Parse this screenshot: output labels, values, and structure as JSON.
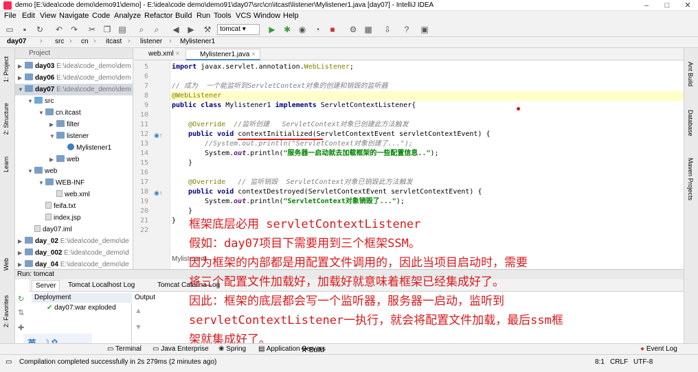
{
  "window": {
    "title": "demo [E:\\idea\\code demo\\demo91\\demo] - E:\\idea\\code demo\\demo91\\day07\\src\\cn\\itcast\\listener\\Mylistener1.java [day07] - IntelliJ IDEA",
    "minimize": "–",
    "maximize": "□",
    "close": "✕"
  },
  "menu": [
    "File",
    "Edit",
    "View",
    "Navigate",
    "Code",
    "Analyze",
    "Refactor",
    "Build",
    "Run",
    "Tools",
    "VCS",
    "Window",
    "Help"
  ],
  "toolbar": {
    "run_config": "tomcat"
  },
  "breadcrumb": [
    "day07",
    "src",
    "cn",
    "itcast",
    "listener",
    "Mylistener1"
  ],
  "left_strip": {
    "project": "1: Project",
    "structure": "2: Structure",
    "learn": "Learn",
    "web": "Web",
    "favorites": "2: Favorites"
  },
  "right_strip": {
    "ant": "Ant Build",
    "database": "Database",
    "maven": "Maven Projects"
  },
  "project": {
    "header": "Project",
    "rows": [
      {
        "name": "day03",
        "path": "E:\\idea\\code_demo\\dem"
      },
      {
        "name": "day06",
        "path": "E:\\idea\\code_demo\\dem"
      },
      {
        "name": "day07",
        "path": "E:\\idea\\code_demo\\dem"
      },
      {
        "name": "src",
        "path": ""
      },
      {
        "name": "cn.itcast",
        "path": ""
      },
      {
        "name": "filter",
        "path": ""
      },
      {
        "name": "listener",
        "path": ""
      },
      {
        "name": "Mylistener1",
        "path": ""
      },
      {
        "name": "web",
        "path": ""
      },
      {
        "name": "web",
        "path": ""
      },
      {
        "name": "WEB-INF",
        "path": ""
      },
      {
        "name": "web.xml",
        "path": ""
      },
      {
        "name": "feifa.txt",
        "path": ""
      },
      {
        "name": "index.jsp",
        "path": ""
      },
      {
        "name": "day07.iml",
        "path": ""
      },
      {
        "name": "day_02",
        "path": "E:\\idea\\code_demo\\de"
      },
      {
        "name": "day_002",
        "path": "E:\\idea\\code_demo\\d"
      },
      {
        "name": "day_04",
        "path": "E:\\idea\\code_demo\\de"
      }
    ]
  },
  "tabs": [
    "web.xml",
    "Mylistener1.java"
  ],
  "editor": {
    "line_numbers": [
      "5",
      "6",
      "7",
      "8",
      "9",
      "10",
      "11",
      "12",
      "13",
      "14",
      "15",
      "16",
      "17",
      "18",
      "19",
      "20",
      "21",
      "22"
    ],
    "lines": {
      "l5_a": "import ",
      "l5_b": "javax.servlet.annotation.",
      "l5_c": "WebListener",
      "l5_d": ";",
      "l7": "// 成为  一个能监听到ServletContext对象的创建和销毁的监听器",
      "l8": "@WebListener",
      "l9_a": "public class ",
      "l9_b": "Mylistener1 ",
      "l9_c": "implements ",
      "l9_d": "ServletContextListener{",
      "l11_a": "@Override",
      "l11_b": "  //监听创建   ServletContext对象已创建此方法触发",
      "l12_a": "public void ",
      "l12_b": "contextInitialized(ServletContextEvent servletContextEvent) {",
      "l13": "//System.out.println(\"ServletContext对象创建了...\");",
      "l14_a": "System.",
      "l14_b": "out",
      "l14_c": ".println(",
      "l14_d": "\"服务器一启动就去加载框架的一些配置信息..\"",
      "l14_e": ");",
      "l15": "}",
      "l17_a": "@Override",
      "l17_b": "   // 监听销毁  ServletContext对象已销毁此方法触发",
      "l18_a": "public void ",
      "l18_b": "contextDestroyed(ServletContextEvent servletContextEvent) {",
      "l19_a": "System.",
      "l19_b": "out",
      "l19_c": ".println(",
      "l19_d": "\"ServletContext对象销毁了...\"",
      "l19_e": ");",
      "l20": "}",
      "l21": "}"
    },
    "crumb_bottom": "Mylistener1"
  },
  "overlay_notes": [
    "框架底层必用 servletContextListener",
    "假如：day07项目下需要用到三个框架SSM。",
    "因为框架的内部都是用配置文件调用的，因此当项目启动时，需要",
    "将三个配置文件加载好，加载好就意味着框架已经集成好了。",
    "因此：框架的底层都会写一个监听器，服务器一启动，监听到",
    "servletContextListener一执行，就会将配置文件加载，最后ssm框",
    "架就集成好了。"
  ],
  "run": {
    "header_label": "Run",
    "config": "tomcat",
    "tabs": [
      "Server",
      "Tomcat Localhost Log",
      "Tomcat Catalina Log"
    ],
    "deployment_header": "Deployment",
    "output_header": "Output",
    "deployment_item": "day07:war exploded"
  },
  "tool_windows": [
    "Terminal",
    "Java Enterprise",
    "Spring",
    "Application Servers",
    "Build",
    "Event Log"
  ],
  "status": {
    "message": "Compilation completed successfully in 2s 279ms (2 minutes ago)",
    "position": "8:1",
    "line_sep": "CRLF",
    "encoding": "UTF-8"
  },
  "ime": {
    "label": "英"
  },
  "colors": {
    "overlay_red": "#d8191b",
    "keyword": "#000080",
    "annotation": "#808000",
    "string": "#008000"
  }
}
